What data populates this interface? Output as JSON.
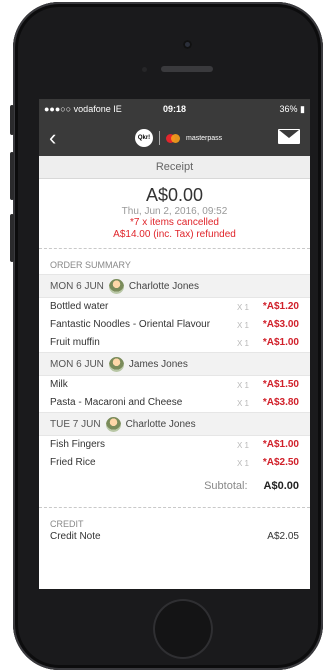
{
  "status": {
    "carrier": "●●●○○ vodafone IE",
    "time": "09:18",
    "battery": "36%"
  },
  "nav": {
    "brand": "masterpass",
    "app_badge": "Qkr!"
  },
  "title": "Receipt",
  "receipt": {
    "amount": "A$0.00",
    "date": "Thu, Jun 2, 2016, 09:52",
    "cancelled": "*7 x items cancelled",
    "refunded": "A$14.00 (inc. Tax) refunded"
  },
  "order_summary_label": "ORDER SUMMARY",
  "days": [
    {
      "date": "MON 6 JUN",
      "name": "Charlotte Jones",
      "items": [
        {
          "name": "Bottled water",
          "qty": "X 1",
          "price": "*A$1.20"
        },
        {
          "name": "Fantastic Noodles - Oriental Flavour",
          "qty": "X 1",
          "price": "*A$3.00"
        },
        {
          "name": "Fruit muffin",
          "qty": "X 1",
          "price": "*A$1.00"
        }
      ]
    },
    {
      "date": "MON 6 JUN",
      "name": "James Jones",
      "items": [
        {
          "name": "Milk",
          "qty": "X 1",
          "price": "*A$1.50"
        },
        {
          "name": "Pasta - Macaroni and Cheese",
          "qty": "X 1",
          "price": "*A$3.80"
        }
      ]
    },
    {
      "date": "TUE 7 JUN",
      "name": "Charlotte Jones",
      "items": [
        {
          "name": "Fish Fingers",
          "qty": "X 1",
          "price": "*A$1.00"
        },
        {
          "name": "Fried Rice",
          "qty": "X 1",
          "price": "*A$2.50"
        }
      ]
    }
  ],
  "subtotal": {
    "label": "Subtotal:",
    "value": "A$0.00"
  },
  "credit": {
    "label": "CREDIT",
    "item": "Credit Note",
    "value": "A$2.05"
  }
}
